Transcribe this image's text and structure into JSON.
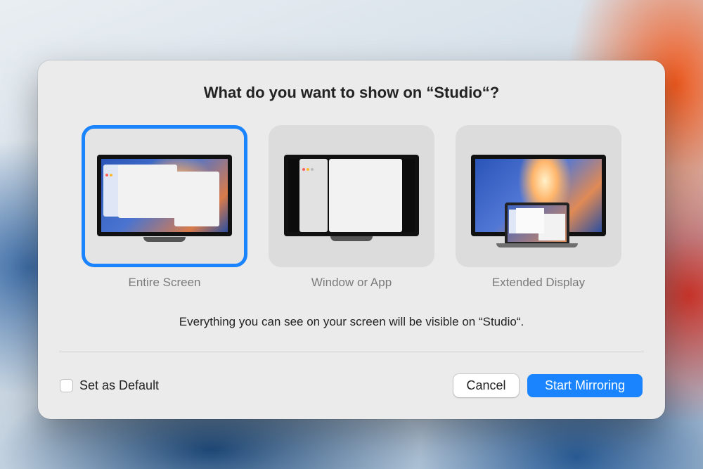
{
  "dialog": {
    "title": "What do you want to show on “Studio“?",
    "description": "Everything you can see on your screen will be visible on “Studio“.",
    "options": [
      {
        "label": "Entire Screen",
        "selected": true
      },
      {
        "label": "Window or App",
        "selected": false
      },
      {
        "label": "Extended Display",
        "selected": false
      }
    ],
    "set_default_label": "Set as Default",
    "set_default_checked": false,
    "cancel_label": "Cancel",
    "start_label": "Start Mirroring"
  },
  "colors": {
    "accent": "#1a84ff",
    "dialog_bg": "#ebebeb",
    "window_dot_red": "#ff5f57",
    "window_dot_yellow": "#febc2e"
  }
}
